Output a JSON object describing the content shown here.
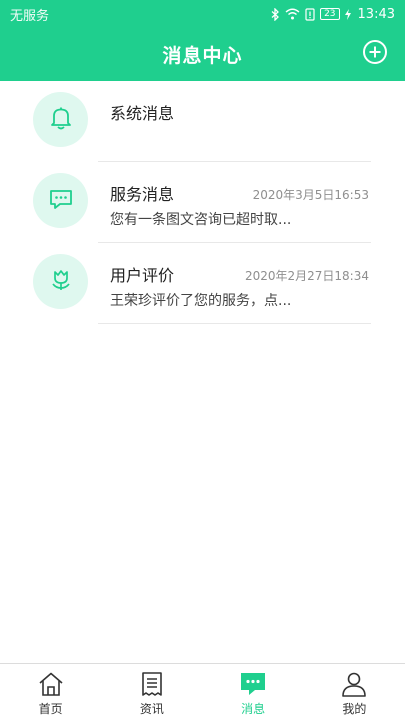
{
  "colors": {
    "accent": "#1fcf8e",
    "avatar_bg": "#dff8ef",
    "tab_inactive": "#333333"
  },
  "status_bar": {
    "carrier": "无服务",
    "battery": "23",
    "time": "13:43"
  },
  "header": {
    "title": "消息中心",
    "add_icon": "plus-circle-icon"
  },
  "messages": [
    {
      "icon": "bell-icon",
      "title": "系统消息",
      "time": "",
      "preview": ""
    },
    {
      "icon": "chat-bubble-icon",
      "title": "服务消息",
      "time": "2020年3月5日16:53",
      "preview": "您有一条图文咨询已超时取..."
    },
    {
      "icon": "tulip-icon",
      "title": "用户评价",
      "time": "2020年2月27日18:34",
      "preview": "王荣珍评价了您的服务，点..."
    }
  ],
  "tabs": [
    {
      "label": "首页",
      "icon": "home-icon"
    },
    {
      "label": "资讯",
      "icon": "document-icon"
    },
    {
      "label": "消息",
      "icon": "message-icon",
      "active": true
    },
    {
      "label": "我的",
      "icon": "user-icon"
    }
  ]
}
